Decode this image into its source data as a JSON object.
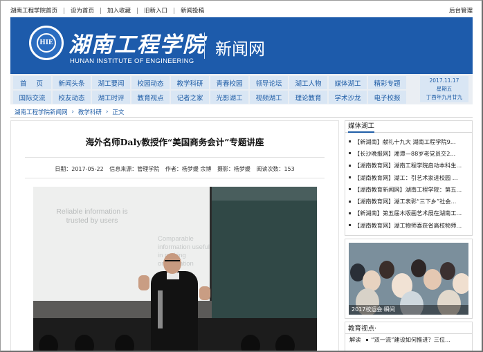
{
  "topbar": {
    "links": [
      "湖南工程学院首页",
      "设为首页",
      "加入收藏",
      "旧新入口",
      "新闻投稿"
    ],
    "admin": "后台管理"
  },
  "header": {
    "title_cn": "湖南工程学院",
    "title_en": "HUNAN INSTITUTE OF ENGINEERING",
    "site_name": "新闻网",
    "badge_text": "HIE"
  },
  "nav": {
    "row1": [
      "首页",
      "新闻头条",
      "湖工要闻",
      "校园动态",
      "教学科研",
      "青春校园",
      "领导论坛",
      "湖工人物",
      "媒体湖工",
      "精彩专题"
    ],
    "row2": [
      "国际交流",
      "校友动态",
      "湖工时评",
      "教育视点",
      "记者之家",
      "光影湖工",
      "视频湖工",
      "理论教育",
      "学术沙龙",
      "电子校报"
    ],
    "date_line1": "2017.11.17",
    "date_line2": "星期五",
    "date_line3": "丁酉年九月廿九"
  },
  "breadcrumb": [
    "湖南工程学院新闻网",
    "教学科研",
    "正文"
  ],
  "article": {
    "title": "海外名师Daly教授作“美国商务会计”专题讲座",
    "meta_date": "日期：2017-05-22",
    "meta_source": "信息来源：管理学院",
    "meta_author": "作者：杨梦媛 余博",
    "meta_photo": "摄影：杨梦媛",
    "meta_views": "阅读次数：153"
  },
  "photo_text": {
    "slide1": "Reliable information is trusted by users",
    "slide2": "Comparable information useful in making organization"
  },
  "sidebar": {
    "media_title": "媒体湖工",
    "media_items": [
      "【新湖南】献礼十九大 湖南工程学院9...",
      "【长沙晚报网】湘潭—88岁老党员交2...",
      "【湖南教育网】湖南工程学院启动本科生...",
      "【湖南教育网】湖工：引艺术家进校园 ...",
      "【湖南教育新闻网】湖南工程学院：第五...",
      "【湖南教育网】湖工表彰“三下乡”社会...",
      "【新湖南】第五届木版画艺术展在湖南工...",
      "【湖南教育网】湖工物师喜获省高校物师..."
    ],
    "photo_caption": "2017校运会·瞬间",
    "edu_title": "教育视点·",
    "edu_label": "解读",
    "edu_item": "“双一流”建设如何推进？三位..."
  },
  "colors": {
    "brand_blue": "#1d5bab",
    "nav_bg": "#d9e6f4",
    "nav_text": "#1f5da6"
  }
}
